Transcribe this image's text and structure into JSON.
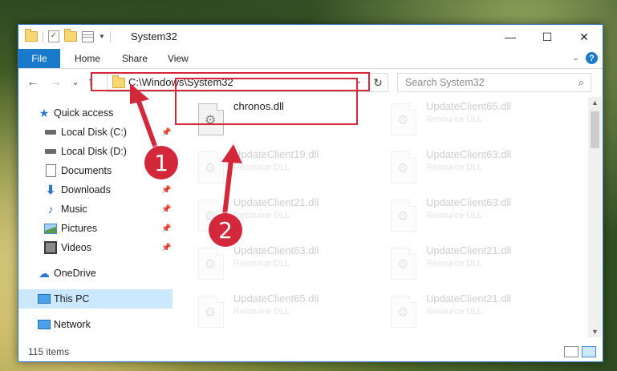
{
  "window": {
    "title": "System32",
    "controls": {
      "minimize": "—",
      "maximize": "☐",
      "close": "✕"
    }
  },
  "ribbon": {
    "tabs": [
      "File",
      "Home",
      "Share",
      "View"
    ],
    "help": "?"
  },
  "nav": {
    "back": "←",
    "forward": "→",
    "recent": "⌄",
    "up": "↑",
    "address": "C:\\Windows\\System32",
    "refresh": "↻",
    "search_placeholder": "Search System32"
  },
  "sidebar": {
    "items": [
      {
        "label": "Quick access",
        "icon": "star-icon"
      },
      {
        "label": "Local Disk (C:)",
        "icon": "drive-icon"
      },
      {
        "label": "Local Disk (D:)",
        "icon": "drive-icon"
      },
      {
        "label": "Documents",
        "icon": "documents-icon"
      },
      {
        "label": "Downloads",
        "icon": "downloads-icon"
      },
      {
        "label": "Music",
        "icon": "music-icon"
      },
      {
        "label": "Pictures",
        "icon": "pictures-icon"
      },
      {
        "label": "Videos",
        "icon": "videos-icon"
      },
      {
        "label": "OneDrive",
        "icon": "cloud-icon"
      },
      {
        "label": "This PC",
        "icon": "computer-icon"
      },
      {
        "label": "Network",
        "icon": "network-icon"
      }
    ]
  },
  "files": [
    {
      "name": "chronos.dll",
      "type": ""
    },
    {
      "name": "UpdateClient65.dll",
      "type": "Resource DLL"
    },
    {
      "name": "UpdateClient19.dll",
      "type": "Resource DLL"
    },
    {
      "name": "UpdateClient63.dll",
      "type": "Resource DLL"
    },
    {
      "name": "UpdateClient21.dll",
      "type": "Resource DLL"
    },
    {
      "name": "UpdateClient63.dll",
      "type": "Resource DLL"
    },
    {
      "name": "UpdateClient63.dll",
      "type": "Resource DLL"
    },
    {
      "name": "UpdateClient21.dll",
      "type": "Resource DLL"
    },
    {
      "name": "UpdateClient65.dll",
      "type": "Resource DLL"
    },
    {
      "name": "UpdateClient21.dll",
      "type": "Resource DLL"
    }
  ],
  "status": {
    "items_count": "115 items"
  },
  "annotations": {
    "badge1": "1",
    "badge2": "2",
    "color": "#d3283a"
  }
}
